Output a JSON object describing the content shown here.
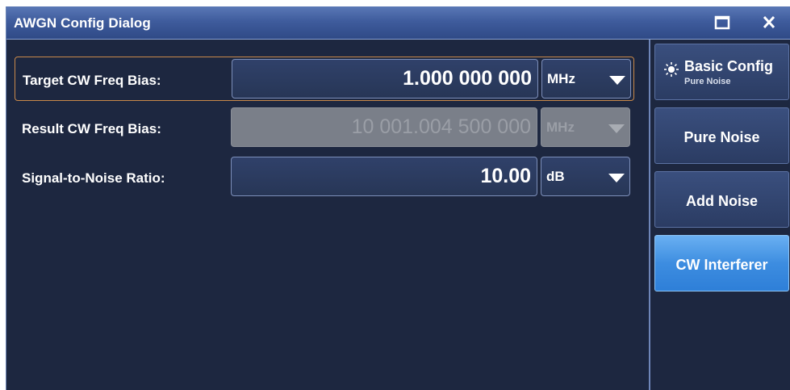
{
  "window": {
    "title": "AWGN Config Dialog"
  },
  "fields": [
    {
      "label": "Target CW Freq Bias:",
      "value": "1.000 000 000",
      "unit": "MHz",
      "state": "focused"
    },
    {
      "label": "Result CW Freq Bias:",
      "value": "10 001.004 500 000",
      "unit": "MHz",
      "state": "disabled"
    },
    {
      "label": "Signal-to-Noise Ratio:",
      "value": "10.00",
      "unit": "dB",
      "state": "normal"
    }
  ],
  "sidebar": {
    "basic_config": {
      "label": "Basic Config",
      "sublabel": "Pure Noise",
      "icon": "gear-icon"
    },
    "buttons": [
      {
        "label": "Pure Noise"
      },
      {
        "label": "Add Noise"
      },
      {
        "label": "CW Interferer",
        "active": true
      }
    ]
  },
  "colors": {
    "background": "#1d2740",
    "titlebar": "#3f5c9d",
    "focus_border": "#c9894a",
    "active_button": "#3d8de0"
  }
}
